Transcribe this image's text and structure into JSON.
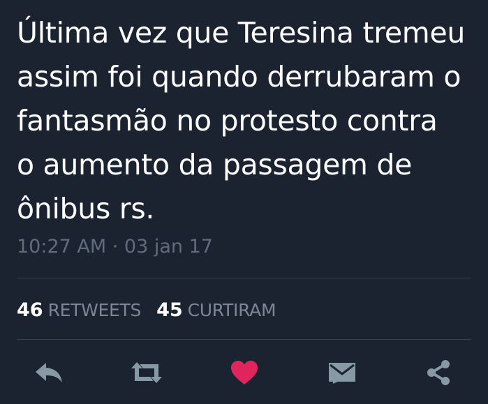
{
  "tweet": {
    "text": "Última vez que Teresina tremeu\nassim foi quando derrubaram o\nfantasmão no protesto contra\no aumento da passagem de\nônibus rs.",
    "timestamp": "10:27 AM · 03 jan 17"
  },
  "stats": {
    "retweets_count": "46",
    "retweets_label": "RETWEETS",
    "likes_count": "45",
    "likes_label": "CURTIRAM"
  },
  "actions": [
    {
      "icon": "reply-icon"
    },
    {
      "icon": "retweet-icon"
    },
    {
      "icon": "heart-icon",
      "active": true,
      "color": "#e0245e"
    },
    {
      "icon": "envelope-icon"
    },
    {
      "icon": "share-icon"
    }
  ],
  "colors": {
    "background": "#1b2331",
    "text": "#ffffff",
    "muted": "#5f6c7d",
    "icon": "#8899a6",
    "like": "#e0245e"
  }
}
